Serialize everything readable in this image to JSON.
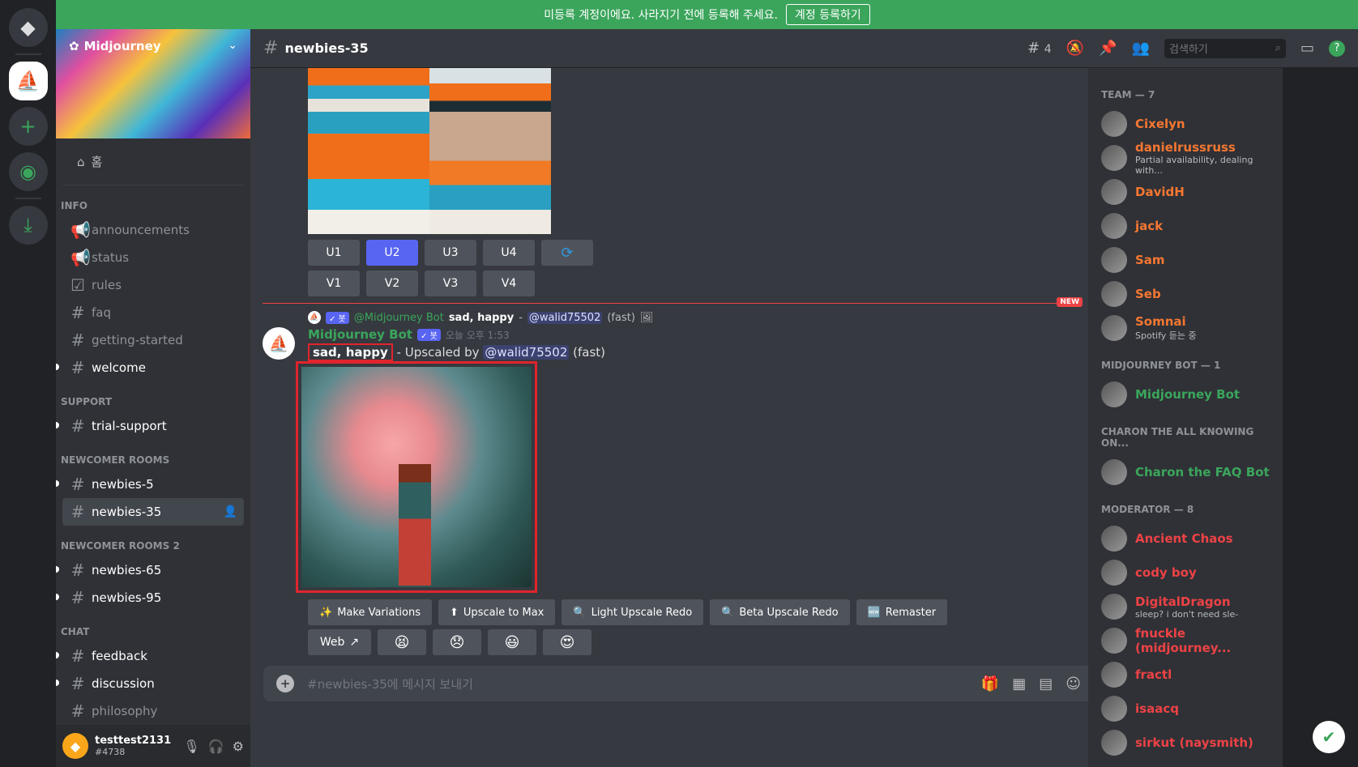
{
  "banner": {
    "text": "미등록 계정이에요. 사라지기 전에 등록해 주세요.",
    "button": "계정 등록하기"
  },
  "server": {
    "name": "Midjourney"
  },
  "sidebar": {
    "home": "홈",
    "categories": [
      {
        "name": "INFO",
        "channels": [
          "announcements",
          "status",
          "rules",
          "faq",
          "getting-started",
          "welcome"
        ]
      },
      {
        "name": "SUPPORT",
        "channels": [
          "trial-support"
        ]
      },
      {
        "name": "NEWCOMER ROOMS",
        "channels": [
          "newbies-5",
          "newbies-35"
        ]
      },
      {
        "name": "NEWCOMER ROOMS 2",
        "channels": [
          "newbies-65",
          "newbies-95"
        ]
      },
      {
        "name": "CHAT",
        "channels": [
          "feedback",
          "discussion",
          "philosophy"
        ]
      }
    ]
  },
  "user": {
    "name": "testtest2131",
    "tag": "#4738"
  },
  "topbar": {
    "channel": "newbies-35",
    "threads": "4",
    "search_placeholder": "검색하기"
  },
  "upscale_buttons": [
    "U1",
    "U2",
    "U3",
    "U4"
  ],
  "variation_buttons": [
    "V1",
    "V2",
    "V3",
    "V4"
  ],
  "new_label": "NEW",
  "reply": {
    "author": "@Midjourney Bot",
    "prompt": "sad, happy",
    "sep": "-",
    "mention": "@walid75502",
    "speed": "(fast)",
    "bot_badge": "✓ 봇"
  },
  "message": {
    "author": "Midjourney Bot",
    "bot_badge": "✓ 봇",
    "timestamp": "오늘 오후 1:53",
    "prompt": "sad, happy",
    "text": " - Upscaled by ",
    "mention": "@walid75502",
    "speed": " (fast)"
  },
  "action_buttons": [
    "Make Variations",
    "Upscale to Max",
    "Light Upscale Redo",
    "Beta Upscale Redo",
    "Remaster"
  ],
  "web_button": "Web",
  "composer": {
    "placeholder": "#newbies-35에 메시지 보내기"
  },
  "members": {
    "groups": [
      {
        "title": "TEAM — 7",
        "items": [
          {
            "name": "Cixelyn",
            "sub": "",
            "color": "#f57731"
          },
          {
            "name": "danielrussruss",
            "sub": "Partial availability, dealing with...",
            "color": "#f57731"
          },
          {
            "name": "DavidH",
            "sub": "",
            "color": "#f57731"
          },
          {
            "name": "jack",
            "sub": "",
            "color": "#f57731"
          },
          {
            "name": "Sam",
            "sub": "",
            "color": "#f57731"
          },
          {
            "name": "Seb",
            "sub": "",
            "color": "#f57731"
          },
          {
            "name": "Somnai",
            "sub": "Spotify 듣는 중",
            "color": "#f57731"
          }
        ]
      },
      {
        "title": "MIDJOURNEY BOT — 1",
        "items": [
          {
            "name": "Midjourney Bot",
            "sub": "",
            "color": "#3ba55c"
          }
        ]
      },
      {
        "title": "CHARON THE ALL KNOWING ON...",
        "items": [
          {
            "name": "Charon the FAQ Bot",
            "sub": "",
            "color": "#3ba55c"
          }
        ]
      },
      {
        "title": "MODERATOR — 8",
        "items": [
          {
            "name": "Ancient Chaos",
            "sub": "",
            "color": "#ed4245"
          },
          {
            "name": "cody boy",
            "sub": "",
            "color": "#ed4245"
          },
          {
            "name": "DigitalDragon",
            "sub": "sleep? i don't need sle-",
            "color": "#ed4245"
          },
          {
            "name": "fnuckle (midjourney...",
            "sub": "",
            "color": "#ed4245"
          },
          {
            "name": "fractl",
            "sub": "",
            "color": "#ed4245"
          },
          {
            "name": "isaacq",
            "sub": "",
            "color": "#ed4245"
          },
          {
            "name": "sirkut (naysmith)",
            "sub": "",
            "color": "#ed4245"
          }
        ]
      }
    ]
  }
}
